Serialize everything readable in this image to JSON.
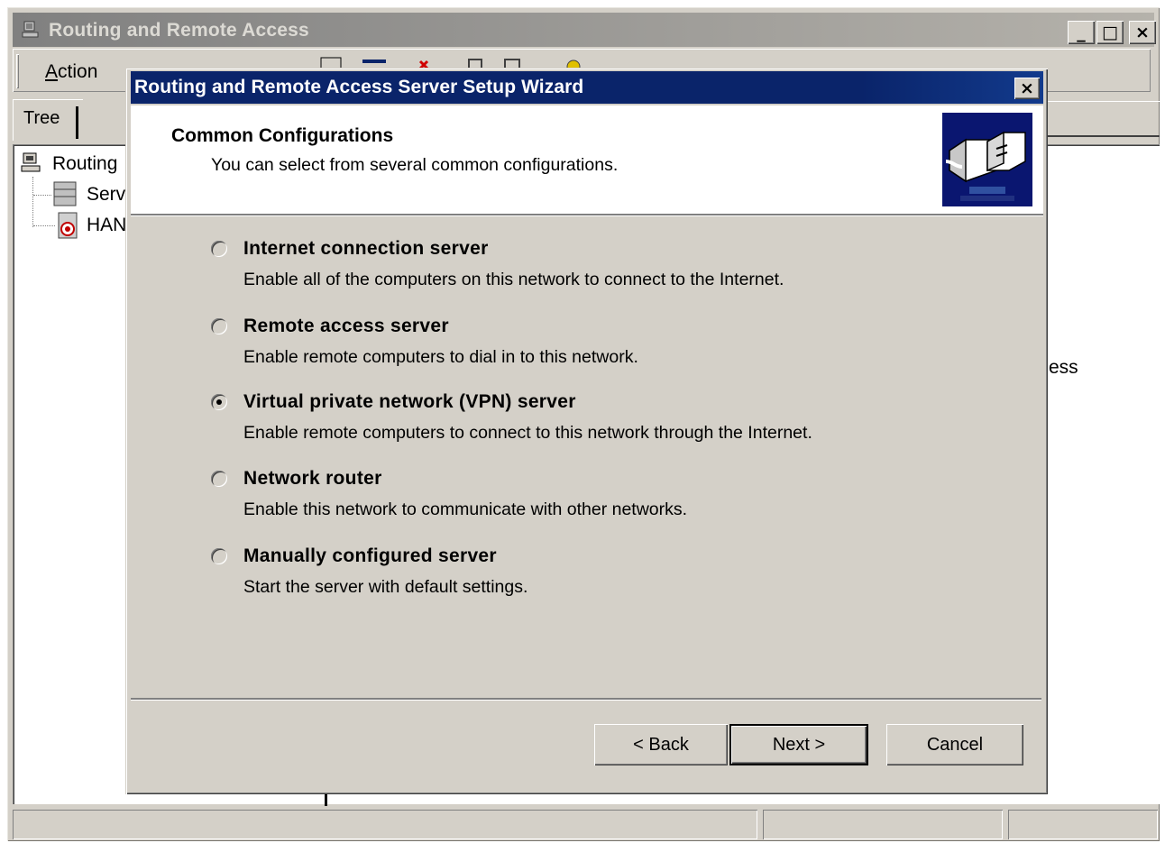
{
  "main_window": {
    "title": "Routing and Remote Access",
    "minimize_glyph": "_",
    "maximize_glyph": "□",
    "close_glyph": "×",
    "menu_action": "ction",
    "menu_action_mnemonic": "A",
    "tree_tab_label": "Tree",
    "tree_items": [
      {
        "label": "Routing",
        "icon": "computer-management-icon"
      },
      {
        "label": "Serv",
        "icon": "server-status-icon"
      },
      {
        "label": "HAN",
        "icon": "server-stopped-icon"
      }
    ],
    "right_pane_fragment": "ess"
  },
  "wizard": {
    "title": "Routing and Remote Access Server Setup Wizard",
    "close_glyph": "×",
    "header_title": "Common Configurations",
    "header_subtitle": "You can select from several common configurations.",
    "header_graphic": "network-connection-icon",
    "options": [
      {
        "label": "Internet connection server",
        "description": "Enable all of the computers on this network to connect to the Internet.",
        "checked": false
      },
      {
        "label": "Remote access server",
        "description": "Enable remote computers to dial in to this network.",
        "checked": false
      },
      {
        "label": "Virtual private network (VPN) server",
        "description": "Enable remote computers to connect to this network through the Internet.",
        "checked": true
      },
      {
        "label": "Network router",
        "description": "Enable this network to communicate with other networks.",
        "checked": false
      },
      {
        "label": "Manually configured server",
        "description": "Start the server with default settings.",
        "checked": false
      }
    ],
    "buttons": {
      "back": "< Back",
      "next": "Next >",
      "cancel": "Cancel"
    }
  },
  "colors": {
    "dialog_face": "#d4d0c8",
    "active_title": "#0a246a",
    "inactive_title": "#808080"
  }
}
